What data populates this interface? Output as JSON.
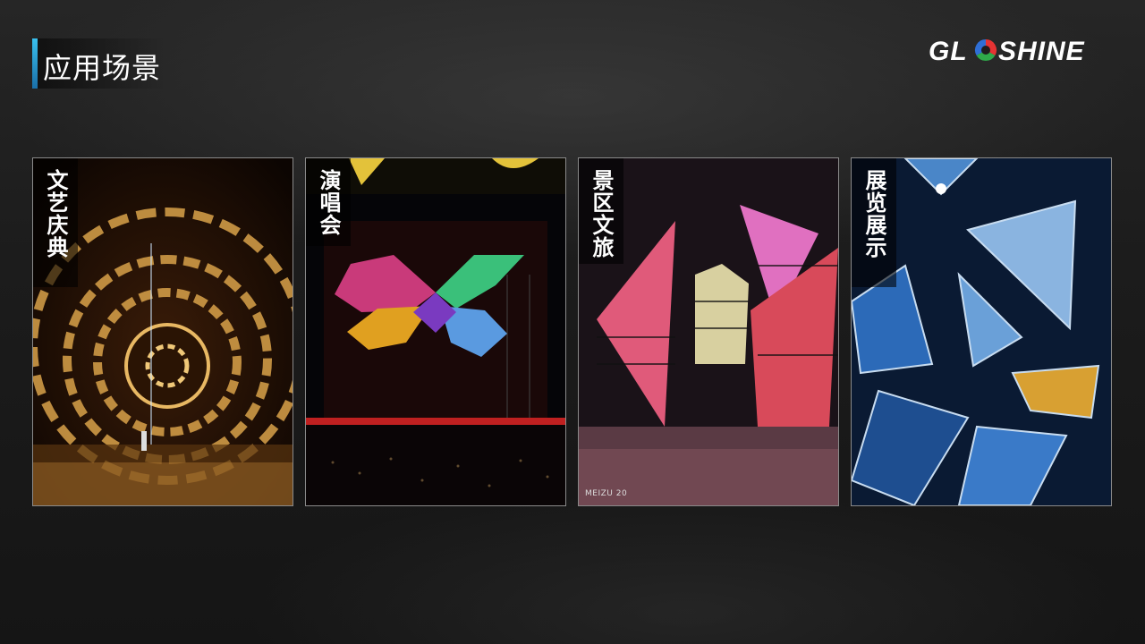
{
  "header": {
    "title": "应用场景",
    "logo_text": "GLOSHINE",
    "accent": "#2fb3e6"
  },
  "cards": [
    {
      "label": "文艺庆典",
      "scene": "circular-tunnel-stage"
    },
    {
      "label": "演唱会",
      "scene": "butterfly-stage"
    },
    {
      "label": "景区文旅",
      "scene": "triangle-pixel-installation",
      "tag": "MEIZU 20"
    },
    {
      "label": "展览展示",
      "scene": "mirrored-triangle-panels"
    }
  ],
  "colors": {
    "background": "#1c1c1c",
    "card_border": "#8a8a8a",
    "logo_red": "#e63333",
    "logo_green": "#2faa4a",
    "logo_blue": "#2f6fd6"
  }
}
